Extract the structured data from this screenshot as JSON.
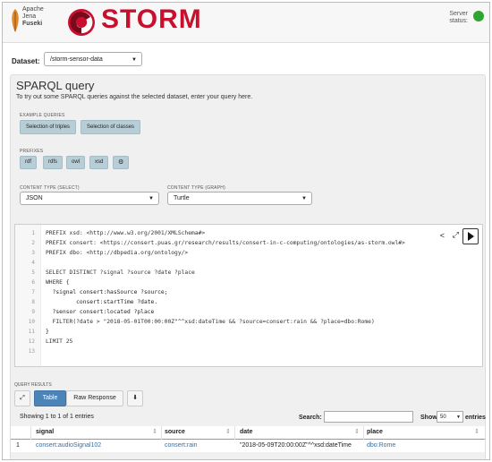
{
  "header": {
    "jena_line1": "Apache",
    "jena_line2": "Jena",
    "jena_line3": "Fuseki",
    "brand": "STORM",
    "server_label_1": "Server",
    "server_label_2": "status:",
    "server_status_color": "#2ea52e"
  },
  "dataset": {
    "label": "Dataset:",
    "value": "/storm-sensor-data"
  },
  "query": {
    "title": "SPARQL query",
    "subtitle": "To try out some SPARQL queries against the selected dataset, enter your query here.",
    "examples_label": "EXAMPLE QUERIES",
    "examples": [
      "Selection of triples",
      "Selection of classes"
    ],
    "prefixes_label": "PREFIXES",
    "prefixes": [
      "rdf",
      "rdfs",
      "owl",
      "xsd"
    ],
    "content_select_label": "CONTENT TYPE (SELECT)",
    "content_select_value": "JSON",
    "content_graph_label": "CONTENT TYPE (GRAPH)",
    "content_graph_value": "Turtle"
  },
  "editor": {
    "lines": [
      "PREFIX xsd: <http://www.w3.org/2001/XMLSchema#>",
      "PREFIX consert: <https://consert.puas.gr/research/results/consert-in-c-computing/ontologies/as-storm.owl#>",
      "PREFIX dbo: <http://dbpedia.org/ontology/>",
      "",
      "SELECT DISTINCT ?signal ?source ?date ?place",
      "WHERE {",
      "  ?signal consert:hasSource ?source;",
      "         consert:startTime ?date.",
      "  ?sensor consert:located ?place",
      "  FILTER(?date > \"2018-05-01T00:00:00Z\"^^xsd:dateTime && ?source=consert:rain && ?place=dbo:Rome)",
      "}",
      "LIMIT 25",
      ""
    ]
  },
  "results": {
    "label": "QUERY RESULTS",
    "tab_table": "Table",
    "tab_raw": "Raw Response",
    "showing": "Showing 1 to 1 of 1 entries",
    "search_label": "Search:",
    "show_label": "Show",
    "show_value": "50",
    "entries_label": "entries",
    "columns": [
      "signal",
      "source",
      "date",
      "place"
    ],
    "rows": [
      {
        "index": "1",
        "signal": "consert:audioSignal102",
        "source": "consert:rain",
        "date": "\"2018-05-09T20:00:00Z\"^^xsd:dateTime",
        "place": "dbo:Rome"
      }
    ]
  }
}
